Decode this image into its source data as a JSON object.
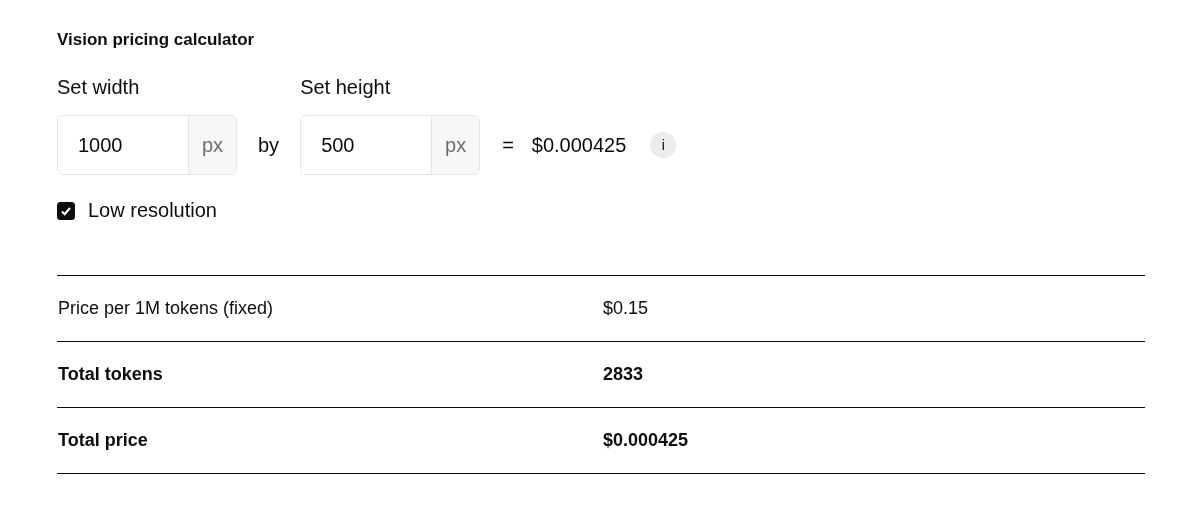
{
  "title": "Vision pricing calculator",
  "width": {
    "label": "Set width",
    "value": "1000",
    "unit": "px"
  },
  "connector": "by",
  "height": {
    "label": "Set height",
    "value": "500",
    "unit": "px"
  },
  "equals": "=",
  "result": "$0.000425",
  "info": "i",
  "low_resolution": {
    "label": "Low resolution",
    "checked": true
  },
  "rows": [
    {
      "kind": "plain",
      "label": "Price per 1M tokens (fixed)",
      "value": "$0.15"
    },
    {
      "kind": "total",
      "label": "Total tokens",
      "value": "2833"
    },
    {
      "kind": "total",
      "label": "Total price",
      "value": "$0.000425"
    }
  ]
}
